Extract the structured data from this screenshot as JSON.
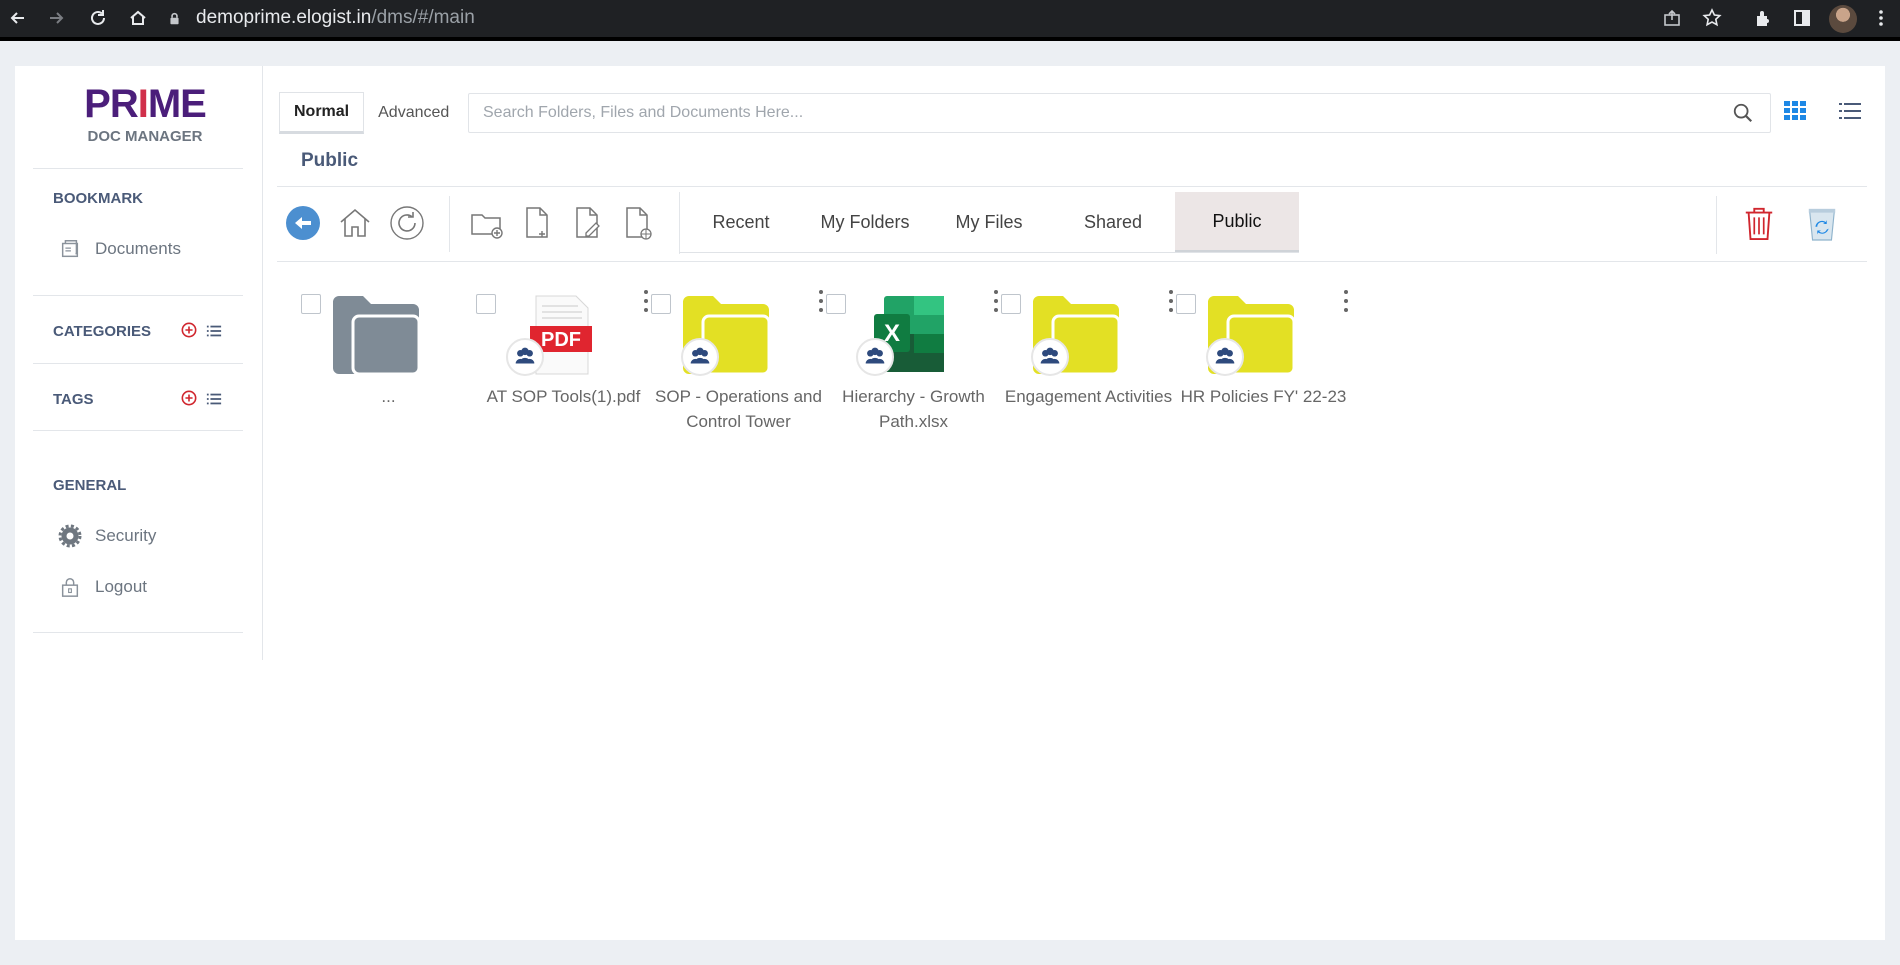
{
  "browser": {
    "url_host": "demoprime.elogist.in",
    "url_path": "/dms/#/main"
  },
  "logo": {
    "prime_a": "PR",
    "prime_b": "I",
    "prime_c": "ME",
    "subtitle": "DOC MANAGER",
    "colors": {
      "primary": "#4b1e7a",
      "accent": "#d0304b"
    }
  },
  "sidebar": {
    "bookmark": {
      "title": "BOOKMARK",
      "items": [
        {
          "label": "Documents",
          "icon": "documents-icon"
        }
      ]
    },
    "categories": {
      "title": "CATEGORIES"
    },
    "tags": {
      "title": "TAGS"
    },
    "general": {
      "title": "GENERAL",
      "items": [
        {
          "label": "Security",
          "icon": "gear-icon"
        },
        {
          "label": "Logout",
          "icon": "lock-icon"
        }
      ]
    }
  },
  "search": {
    "mode_tabs": [
      "Normal",
      "Advanced"
    ],
    "active_mode": "Normal",
    "placeholder": "Search Folders, Files and Documents Here...",
    "value": ""
  },
  "page": {
    "title": "Public"
  },
  "nav_tabs": {
    "items": [
      "Recent",
      "My Folders",
      "My Files",
      "Shared",
      "Public"
    ],
    "active": "Public"
  },
  "files": [
    {
      "name": "...",
      "type": "parent-folder",
      "color": "#7f8b96",
      "badge": false,
      "menu": false
    },
    {
      "name": "AT SOP Tools(1).pdf",
      "type": "pdf",
      "color": "#e0252f",
      "badge": true,
      "menu": true
    },
    {
      "name": "SOP - Operations and Control Tower",
      "type": "folder",
      "color": "#e3e024",
      "badge": true,
      "menu": true
    },
    {
      "name": "Hierarchy - Growth Path.xlsx",
      "type": "xlsx",
      "color": "#1f7a44",
      "badge": true,
      "menu": true
    },
    {
      "name": "Engagement Activities",
      "type": "folder",
      "color": "#e3e024",
      "badge": true,
      "menu": true
    },
    {
      "name": "HR Policies FY' 22-23",
      "type": "folder",
      "color": "#e3e024",
      "badge": true,
      "menu": true
    }
  ],
  "colors": {
    "heading": "#4a5a78",
    "back_button": "#4c8fd0",
    "delete": "#d0262e",
    "recycle": "#4a9fd8",
    "grid_view": "#1e88e5"
  }
}
